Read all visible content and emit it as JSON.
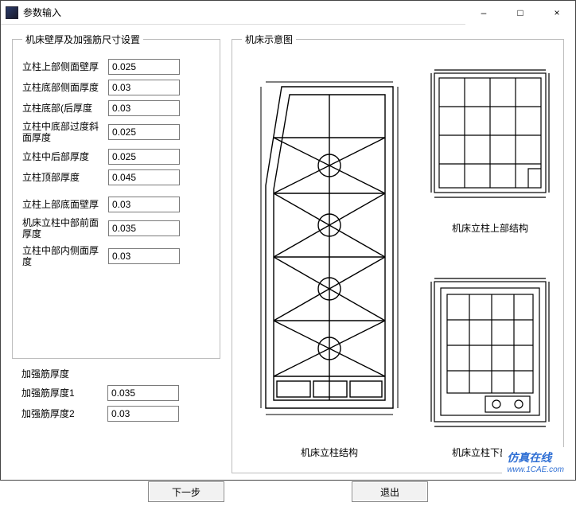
{
  "window": {
    "title": "参数输入",
    "minimize_label": "–",
    "maximize_label": "□",
    "close_label": "×"
  },
  "left_group": {
    "legend": "机床壁厚及加强筋尺寸设置",
    "fields": [
      {
        "label": "立柱上部侧面壁厚",
        "value": "0.025"
      },
      {
        "label": "立柱底部侧面厚度",
        "value": "0.03"
      },
      {
        "label": "立柱底部(后厚度",
        "value": "0.03"
      },
      {
        "label": "立柱中底部过度斜面厚度",
        "value": "0.025"
      },
      {
        "label": "立柱中后部厚度",
        "value": "0.025"
      },
      {
        "label": "立柱顶部厚度",
        "value": "0.045"
      },
      {
        "label": "立柱上部底面壁厚",
        "value": "0.03"
      },
      {
        "label": "机床立柱中部前面厚度",
        "value": "0.035"
      },
      {
        "label": "立柱中部内侧面厚度",
        "value": "0.03"
      }
    ],
    "sub_heading": "加强筋厚度",
    "sub_fields": [
      {
        "label": "加强筋厚度1",
        "value": "0.035"
      },
      {
        "label": "加强筋厚度2",
        "value": "0.03"
      }
    ]
  },
  "right_group": {
    "legend": "机床示意图",
    "captions": {
      "top_right": "机床立柱上部结构",
      "main": "机床立柱结构",
      "bottom_right": "机床立柱下部结构"
    }
  },
  "buttons": {
    "next": "下一步",
    "exit": "退出"
  },
  "watermark": {
    "brand": "仿真在线",
    "url": "www.1CAE.com"
  }
}
